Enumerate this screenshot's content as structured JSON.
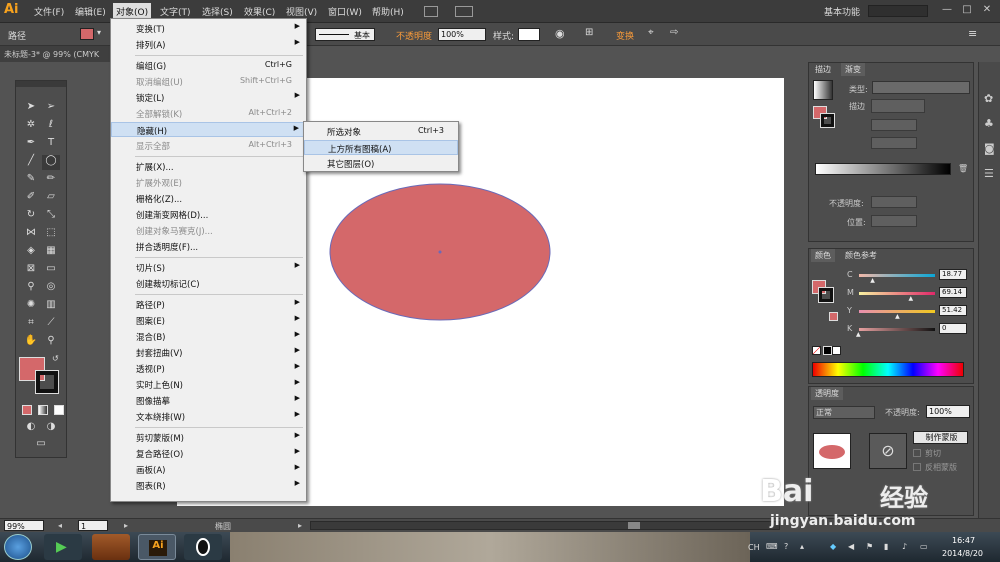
{
  "app": {
    "logo_text": "Ai",
    "brand_color": "#f7a21e"
  },
  "menubar": {
    "items": [
      "文件(F)",
      "编辑(E)",
      "对象(O)",
      "文字(T)",
      "选择(S)",
      "效果(C)",
      "视图(V)",
      "窗口(W)",
      "帮助(H)"
    ],
    "workspace": "基本功能",
    "window_buttons": [
      "—",
      "□",
      "✕"
    ]
  },
  "controlbar": {
    "selection_label": "路径",
    "stroke_style": "基本",
    "opacity_label": "不透明度",
    "opacity_value": "100%",
    "style_label": "样式:",
    "transform_label": "变换"
  },
  "doc_tab": {
    "title": "未标题-3* @ 99% (CMYK"
  },
  "object_menu": {
    "items": [
      {
        "label": "变换(T)",
        "shortcut": "",
        "arrow": "▶",
        "disabled": false
      },
      {
        "label": "排列(A)",
        "shortcut": "",
        "arrow": "▶",
        "disabled": false
      },
      {
        "label": "编组(G)",
        "shortcut": "Ctrl+G",
        "arrow": "",
        "disabled": false
      },
      {
        "label": "取消编组(U)",
        "shortcut": "Shift+Ctrl+G",
        "arrow": "",
        "disabled": true
      },
      {
        "label": "锁定(L)",
        "shortcut": "",
        "arrow": "▶",
        "disabled": false
      },
      {
        "label": "全部解锁(K)",
        "shortcut": "Alt+Ctrl+2",
        "arrow": "",
        "disabled": true
      },
      {
        "label": "隐藏(H)",
        "shortcut": "",
        "arrow": "▶",
        "disabled": false
      },
      {
        "label": "显示全部",
        "shortcut": "Alt+Ctrl+3",
        "arrow": "",
        "disabled": true
      },
      {
        "label": "扩展(X)...",
        "shortcut": "",
        "arrow": "",
        "disabled": false
      },
      {
        "label": "扩展外观(E)",
        "shortcut": "",
        "arrow": "",
        "disabled": true
      },
      {
        "label": "栅格化(Z)...",
        "shortcut": "",
        "arrow": "",
        "disabled": false
      },
      {
        "label": "创建渐变网格(D)...",
        "shortcut": "",
        "arrow": "",
        "disabled": false
      },
      {
        "label": "创建对象马赛克(J)...",
        "shortcut": "",
        "arrow": "",
        "disabled": true
      },
      {
        "label": "拼合透明度(F)...",
        "shortcut": "",
        "arrow": "",
        "disabled": false
      },
      {
        "label": "切片(S)",
        "shortcut": "",
        "arrow": "▶",
        "disabled": false
      },
      {
        "label": "创建裁切标记(C)",
        "shortcut": "",
        "arrow": "",
        "disabled": false
      },
      {
        "label": "路径(P)",
        "shortcut": "",
        "arrow": "▶",
        "disabled": false
      },
      {
        "label": "图案(E)",
        "shortcut": "",
        "arrow": "▶",
        "disabled": false
      },
      {
        "label": "混合(B)",
        "shortcut": "",
        "arrow": "▶",
        "disabled": false
      },
      {
        "label": "封套扭曲(V)",
        "shortcut": "",
        "arrow": "▶",
        "disabled": false
      },
      {
        "label": "透视(P)",
        "shortcut": "",
        "arrow": "▶",
        "disabled": false
      },
      {
        "label": "实时上色(N)",
        "shortcut": "",
        "arrow": "▶",
        "disabled": false
      },
      {
        "label": "图像描摹",
        "shortcut": "",
        "arrow": "▶",
        "disabled": false
      },
      {
        "label": "文本绕排(W)",
        "shortcut": "",
        "arrow": "▶",
        "disabled": false
      },
      {
        "label": "剪切蒙版(M)",
        "shortcut": "",
        "arrow": "▶",
        "disabled": false
      },
      {
        "label": "复合路径(O)",
        "shortcut": "",
        "arrow": "▶",
        "disabled": false
      },
      {
        "label": "画板(A)",
        "shortcut": "",
        "arrow": "▶",
        "disabled": false
      },
      {
        "label": "图表(R)",
        "shortcut": "",
        "arrow": "▶",
        "disabled": false
      }
    ]
  },
  "hide_submenu": {
    "items": [
      {
        "label": "所选对象",
        "shortcut": "Ctrl+3"
      },
      {
        "label": "上方所有图稿(A)",
        "shortcut": ""
      },
      {
        "label": "其它图层(O)",
        "shortcut": ""
      }
    ]
  },
  "gradient_panel": {
    "tabs": [
      "描边",
      "渐变"
    ],
    "type_label": "类型:",
    "stroke_label": "描边",
    "opacity_label": "不透明度:",
    "position_label": "位置:"
  },
  "color_panel": {
    "tabs": [
      "颜色",
      "颜色参考"
    ],
    "channels": [
      {
        "name": "C",
        "value": "18.77",
        "fraction": 0.188
      },
      {
        "name": "M",
        "value": "69.14",
        "fraction": 0.691
      },
      {
        "name": "Y",
        "value": "51.42",
        "fraction": 0.514
      },
      {
        "name": "K",
        "value": "0",
        "fraction": 0.0
      }
    ]
  },
  "transparency_panel": {
    "tab": "透明度",
    "blend_mode": "正常",
    "opacity_label": "不透明度:",
    "opacity_value": "100%",
    "mask_button": "制作蒙版",
    "clip_label": "剪切",
    "invert_label": "反相蒙版"
  },
  "statusbar": {
    "zoom": "99%",
    "page": "1",
    "tool_name": "椭圆"
  },
  "taskbar": {
    "time": "16:47",
    "date": "2014/8/20",
    "lang": "CH"
  },
  "watermark": {
    "brand": "Bai",
    "brand2": "经验",
    "url": "jingyan.baidu.com"
  },
  "colors": {
    "fill": "#d4686a",
    "ellipse_stroke": "#6a6ab8"
  }
}
